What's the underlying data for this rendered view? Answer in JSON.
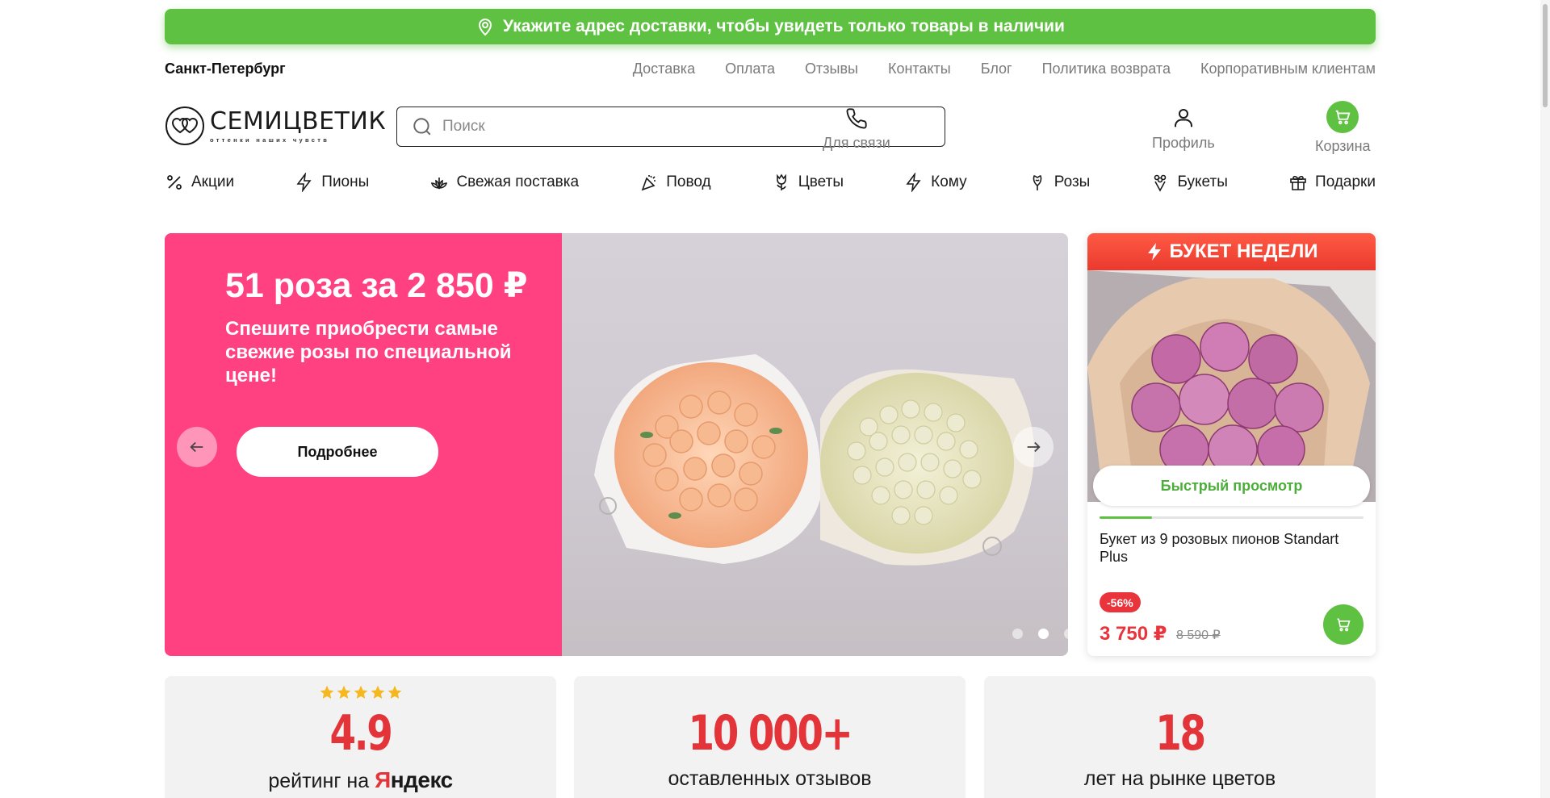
{
  "delivery_banner": {
    "text": "Укажите адрес доставки, чтобы увидеть только товары в наличии",
    "icon": "location-pin-icon"
  },
  "top_bar": {
    "city": "Санкт-Петербург",
    "links": [
      "Доставка",
      "Оплата",
      "Отзывы",
      "Контакты",
      "Блог",
      "Политика возврата",
      "Корпоративным клиентам"
    ]
  },
  "logo": {
    "title": "СЕМИЦВЕТИК",
    "subtitle": "оттенки наших чувств"
  },
  "search": {
    "placeholder": "Поиск",
    "value": ""
  },
  "header_actions": {
    "contact": "Для связи",
    "profile": "Профиль",
    "cart": "Корзина"
  },
  "categories": [
    {
      "label": "Акции",
      "icon": "percent-icon"
    },
    {
      "label": "Пионы",
      "icon": "lightning-icon"
    },
    {
      "label": "Свежая поставка",
      "icon": "lotus-icon"
    },
    {
      "label": "Повод",
      "icon": "party-popper-icon"
    },
    {
      "label": "Цветы",
      "icon": "tulip-icon"
    },
    {
      "label": "Кому",
      "icon": "lightning-icon"
    },
    {
      "label": "Розы",
      "icon": "rose-icon"
    },
    {
      "label": "Букеты",
      "icon": "bouquet-icon"
    },
    {
      "label": "Подарки",
      "icon": "gift-icon"
    }
  ],
  "hero": {
    "title": "51 роза за 2 850 ₽",
    "subtitle": "Спешите приобрести самые свежие розы по специальной цене!",
    "button": "Подробнее",
    "slides_count": 3,
    "active_slide": 2
  },
  "bouquet_of_week": {
    "header": "БУКЕТ НЕДЕЛИ",
    "quick_view": "Быстрый просмотр",
    "name": "Букет из 9 розовых пионов Standart Plus",
    "discount": "-56%",
    "price": "3 750 ₽",
    "old_price": "8 590 ₽",
    "progress": 0.2
  },
  "stats": [
    {
      "value": "4.9",
      "caption_prefix": "рейтинг на",
      "brand_first": "Я",
      "brand_rest": "ндекс",
      "stars": 5
    },
    {
      "value": "10 000+",
      "caption": "оставленных отзывов"
    },
    {
      "value": "18",
      "caption": "лет на рынке цветов"
    }
  ],
  "colors": {
    "green": "#5ec142",
    "pink": "#ff4081",
    "red": "#e8343a"
  }
}
